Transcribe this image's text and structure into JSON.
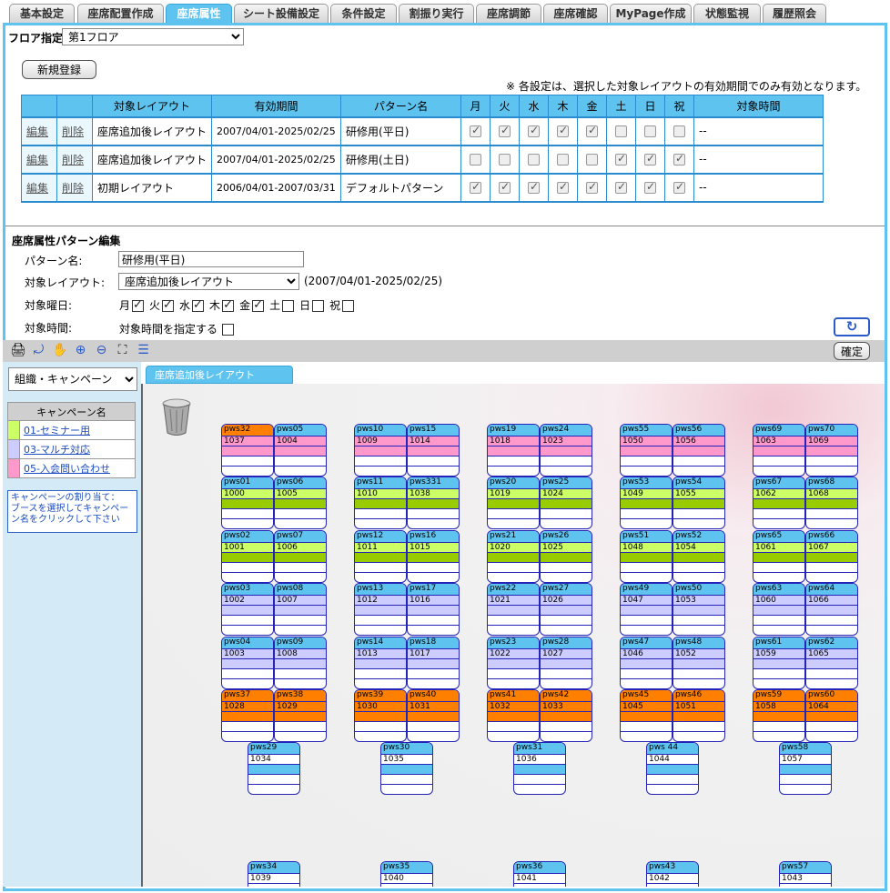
{
  "tabs": [
    {
      "label": "基本設定"
    },
    {
      "label": "座席配置作成"
    },
    {
      "label": "座席属性",
      "active": true
    },
    {
      "label": "シート設備設定"
    },
    {
      "label": "条件設定"
    },
    {
      "label": "割振り実行"
    },
    {
      "label": "座席調節"
    },
    {
      "label": "座席確認"
    },
    {
      "label": "MyPage作成"
    },
    {
      "label": "状態監視"
    },
    {
      "label": "履歴照会"
    }
  ],
  "floor": {
    "label": "フロア指定",
    "value": "第1フロア"
  },
  "new_button": "新規登録",
  "notice": "※ 各設定は、選択した対象レイアウトの有効期間でのみ有効となります。",
  "pattern_table": {
    "headers": [
      "対象レイアウト",
      "有効期間",
      "パターン名",
      "月",
      "火",
      "水",
      "木",
      "金",
      "土",
      "日",
      "祝",
      "対象時間"
    ],
    "edit_label": "編集",
    "delete_label": "削除",
    "rows": [
      {
        "layout": "座席追加後レイアウト",
        "period": "2007/04/01-2025/02/25",
        "pattern": "研修用(平日)",
        "days": [
          true,
          true,
          true,
          true,
          true,
          false,
          false,
          false
        ],
        "time": "--"
      },
      {
        "layout": "座席追加後レイアウト",
        "period": "2007/04/01-2025/02/25",
        "pattern": "研修用(土日)",
        "days": [
          false,
          false,
          false,
          false,
          false,
          true,
          true,
          true
        ],
        "time": "--"
      },
      {
        "layout": "初期レイアウト",
        "period": "2006/04/01-2007/03/31",
        "pattern": "デフォルトパターン",
        "days": [
          true,
          true,
          true,
          true,
          true,
          true,
          true,
          true
        ],
        "time": "--"
      }
    ]
  },
  "editor": {
    "title": "座席属性パターン編集",
    "pattern_name_label": "パターン名:",
    "pattern_name_value": "研修用(平日)",
    "layout_label": "対象レイアウト:",
    "layout_value": "座席追加後レイアウト",
    "layout_period": "(2007/04/01-2025/02/25)",
    "weekday_label": "対象曜日:",
    "weekdays": [
      {
        "label": "月",
        "checked": true
      },
      {
        "label": "火",
        "checked": true
      },
      {
        "label": "水",
        "checked": true
      },
      {
        "label": "木",
        "checked": true
      },
      {
        "label": "金",
        "checked": true
      },
      {
        "label": "土",
        "checked": false
      },
      {
        "label": "日",
        "checked": false
      },
      {
        "label": "祝",
        "checked": false
      }
    ],
    "time_label": "対象時間:",
    "time_check_label": "対象時間を指定する"
  },
  "confirm_button": "確定",
  "toolbar_icons": [
    "print-icon",
    "select-icon",
    "hand-icon",
    "zoom-in-icon",
    "zoom-out-icon",
    "fit-icon",
    "list-icon"
  ],
  "left_panel": {
    "select_value": "組織・キャンペーン",
    "campaign_header": "キャンペーン名",
    "campaigns": [
      {
        "name": "01-セミナー用",
        "color": "#ccff66"
      },
      {
        "name": "03-マルチ対応",
        "color": "#ccccff"
      },
      {
        "name": "05-入会問い合わせ",
        "color": "#ff99cc"
      }
    ],
    "hint": "キャンペーンの割り当て：\nブースを選択してキャンペーン名をクリックして下さい"
  },
  "layout_tab": "座席追加後レイアウト",
  "colors": {
    "accent": "#5fc3ef",
    "header_cyan": "#5fc3ef",
    "orange": "#ff8000",
    "green": "#ccff66",
    "lavender": "#ccccff",
    "pink": "#ff99cc",
    "olive": "#99cc00"
  },
  "seats": [
    {
      "label": "pws32",
      "number": "1037",
      "head": "orange",
      "band": "pink"
    },
    {
      "label": "pws05",
      "number": "1004",
      "head": "cyan",
      "band": "pink"
    },
    {
      "label": "pws10",
      "number": "1009",
      "head": "cyan",
      "band": "pink"
    },
    {
      "label": "pws15",
      "number": "1014",
      "head": "cyan",
      "band": "pink"
    },
    {
      "label": "pws19",
      "number": "1018",
      "head": "cyan",
      "band": "pink"
    },
    {
      "label": "pws24",
      "number": "1023",
      "head": "cyan",
      "band": "pink"
    },
    {
      "label": "pws55",
      "number": "1050",
      "head": "cyan",
      "band": "pink"
    },
    {
      "label": "pws56",
      "number": "1056",
      "head": "cyan",
      "band": "pink"
    },
    {
      "label": "pws69",
      "number": "1063",
      "head": "cyan",
      "band": "pink"
    },
    {
      "label": "pws70",
      "number": "1069",
      "head": "cyan",
      "band": "pink"
    },
    {
      "label": "pws01",
      "number": "1000",
      "head": "cyan",
      "band": "olive"
    },
    {
      "label": "pws06",
      "number": "1005",
      "head": "cyan",
      "band": "olive"
    },
    {
      "label": "pws11",
      "number": "1010",
      "head": "cyan",
      "band": "olive"
    },
    {
      "label": "pws331",
      "number": "1038",
      "head": "cyan",
      "band": "olive"
    },
    {
      "label": "pws20",
      "number": "1019",
      "head": "cyan",
      "band": "olive"
    },
    {
      "label": "pws25",
      "number": "1024",
      "head": "cyan",
      "band": "olive"
    },
    {
      "label": "pws53",
      "number": "1049",
      "head": "cyan",
      "band": "olive"
    },
    {
      "label": "pws54",
      "number": "1055",
      "head": "cyan",
      "band": "olive"
    },
    {
      "label": "pws67",
      "number": "1062",
      "head": "cyan",
      "band": "olive"
    },
    {
      "label": "pws68",
      "number": "1068",
      "head": "cyan",
      "band": "olive"
    },
    {
      "label": "pws02",
      "number": "1001",
      "head": "cyan",
      "band": "olive"
    },
    {
      "label": "pws07",
      "number": "1006",
      "head": "cyan",
      "band": "olive"
    },
    {
      "label": "pws12",
      "number": "1011",
      "head": "cyan",
      "band": "olive"
    },
    {
      "label": "pws16",
      "number": "1015",
      "head": "cyan",
      "band": "olive"
    },
    {
      "label": "pws21",
      "number": "1020",
      "head": "cyan",
      "band": "olive"
    },
    {
      "label": "pws26",
      "number": "1025",
      "head": "cyan",
      "band": "olive"
    },
    {
      "label": "pws51",
      "number": "1048",
      "head": "cyan",
      "band": "olive"
    },
    {
      "label": "pws52",
      "number": "1054",
      "head": "cyan",
      "band": "olive"
    },
    {
      "label": "pws65",
      "number": "1061",
      "head": "cyan",
      "band": "olive"
    },
    {
      "label": "pws66",
      "number": "1067",
      "head": "cyan",
      "band": "olive"
    },
    {
      "label": "pws03",
      "number": "1002",
      "head": "cyan",
      "band": "lavender"
    },
    {
      "label": "pws08",
      "number": "1007",
      "head": "cyan",
      "band": "lavender"
    },
    {
      "label": "pws13",
      "number": "1012",
      "head": "cyan",
      "band": "lavender"
    },
    {
      "label": "pws17",
      "number": "1016",
      "head": "cyan",
      "band": "lavender"
    },
    {
      "label": "pws22",
      "number": "1021",
      "head": "cyan",
      "band": "lavender"
    },
    {
      "label": "pws27",
      "number": "1026",
      "head": "cyan",
      "band": "lavender"
    },
    {
      "label": "pws49",
      "number": "1047",
      "head": "cyan",
      "band": "lavender"
    },
    {
      "label": "pws50",
      "number": "1053",
      "head": "cyan",
      "band": "lavender"
    },
    {
      "label": "pws63",
      "number": "1060",
      "head": "cyan",
      "band": "lavender"
    },
    {
      "label": "pws64",
      "number": "1066",
      "head": "cyan",
      "band": "lavender"
    },
    {
      "label": "pws04",
      "number": "1003",
      "head": "cyan",
      "band": "lavender"
    },
    {
      "label": "pws09",
      "number": "1008",
      "head": "cyan",
      "band": "lavender"
    },
    {
      "label": "pws14",
      "number": "1013",
      "head": "cyan",
      "band": "lavender"
    },
    {
      "label": "pws18",
      "number": "1017",
      "head": "cyan",
      "band": "lavender"
    },
    {
      "label": "pws23",
      "number": "1022",
      "head": "cyan",
      "band": "lavender"
    },
    {
      "label": "pws28",
      "number": "1027",
      "head": "cyan",
      "band": "lavender"
    },
    {
      "label": "pws47",
      "number": "1046",
      "head": "cyan",
      "band": "lavender"
    },
    {
      "label": "pws48",
      "number": "1052",
      "head": "cyan",
      "band": "lavender"
    },
    {
      "label": "pws61",
      "number": "1059",
      "head": "cyan",
      "band": "lavender"
    },
    {
      "label": "pws62",
      "number": "1065",
      "head": "cyan",
      "band": "lavender"
    },
    {
      "label": "pws37",
      "number": "1028",
      "head": "orange",
      "band": "orange"
    },
    {
      "label": "pws38",
      "number": "1029",
      "head": "orange",
      "band": "orange"
    },
    {
      "label": "pws39",
      "number": "1030",
      "head": "orange",
      "band": "orange"
    },
    {
      "label": "pws40",
      "number": "1031",
      "head": "orange",
      "band": "orange"
    },
    {
      "label": "pws41",
      "number": "1032",
      "head": "orange",
      "band": "orange"
    },
    {
      "label": "pws42",
      "number": "1033",
      "head": "orange",
      "band": "orange"
    },
    {
      "label": "pws45",
      "number": "1045",
      "head": "orange",
      "band": "orange"
    },
    {
      "label": "pws46",
      "number": "1051",
      "head": "orange",
      "band": "orange"
    },
    {
      "label": "pws59",
      "number": "1058",
      "head": "orange",
      "band": "orange"
    },
    {
      "label": "pws60",
      "number": "1064",
      "head": "orange",
      "band": "orange"
    },
    {
      "label": "pws29",
      "number": "1034",
      "head": "cyan",
      "band": "cyan"
    },
    {
      "label": "pws30",
      "number": "1035",
      "head": "cyan",
      "band": "cyan"
    },
    {
      "label": "pws31",
      "number": "1036",
      "head": "cyan",
      "band": "cyan"
    },
    {
      "label": "pws 44",
      "number": "1044",
      "head": "cyan",
      "band": "cyan"
    },
    {
      "label": "pws58",
      "number": "1057",
      "head": "cyan",
      "band": "cyan"
    },
    {
      "label": "pws34",
      "number": "1039",
      "head": "cyan",
      "band": "white"
    },
    {
      "label": "pws35",
      "number": "1040",
      "head": "cyan",
      "band": "white"
    },
    {
      "label": "pws36",
      "number": "1041",
      "head": "cyan",
      "band": "white"
    },
    {
      "label": "pws43",
      "number": "1042",
      "head": "cyan",
      "band": "white"
    },
    {
      "label": "pws57",
      "number": "1043",
      "head": "cyan",
      "band": "white"
    }
  ]
}
